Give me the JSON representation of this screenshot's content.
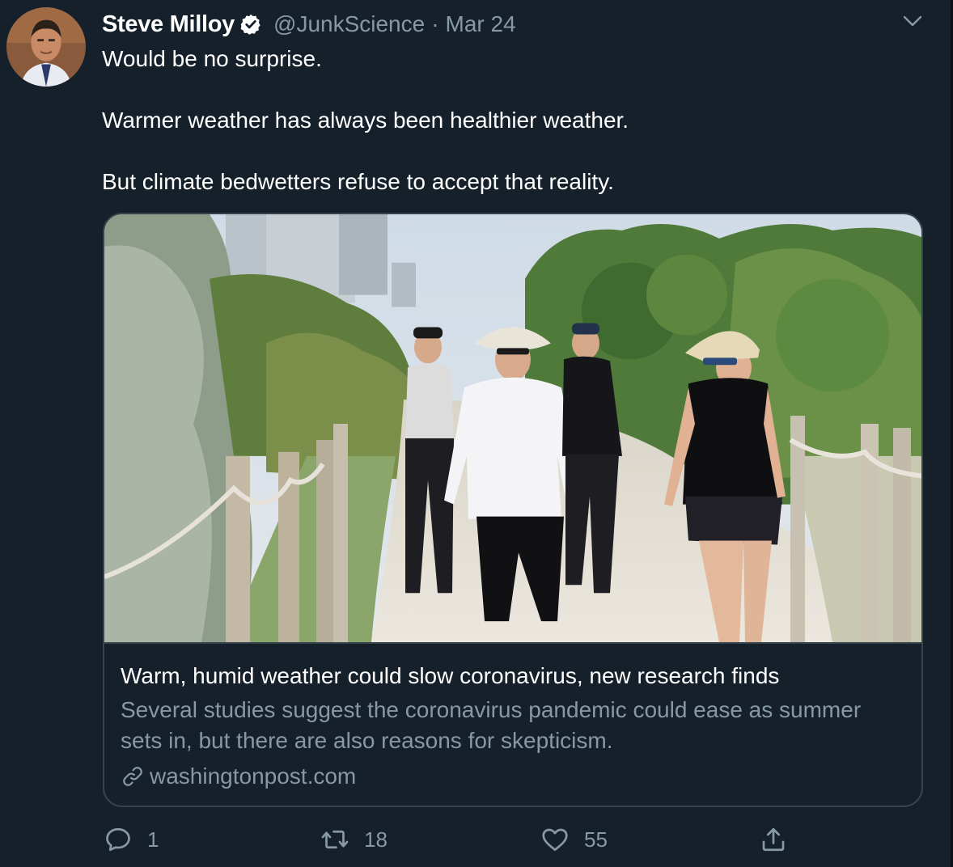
{
  "tweet": {
    "author_name": "Steve Milloy",
    "handle": "@JunkScience",
    "separator": "·",
    "date": "Mar 24",
    "paragraphs": [
      "Would be no surprise.",
      "Warmer weather has always been healthier weather.",
      "But climate bedwetters refuse to accept that reality."
    ]
  },
  "card": {
    "title": "Warm, humid weather could slow coronavirus, new research finds",
    "description": "Several studies suggest the coronavirus pandemic could ease as summer sets in, but there are also reasons for skepticism.",
    "domain": "washingtonpost.com"
  },
  "actions": {
    "reply_count": "1",
    "retweet_count": "18",
    "like_count": "55"
  },
  "icons": {
    "verified": "verified-badge-icon",
    "more": "chevron-down-icon",
    "link": "link-icon",
    "reply": "reply-icon",
    "retweet": "retweet-icon",
    "like": "heart-icon",
    "share": "share-icon"
  },
  "colors": {
    "background": "#15202b",
    "text_primary": "#ffffff",
    "text_secondary": "#8899a6",
    "border": "#38444d"
  }
}
